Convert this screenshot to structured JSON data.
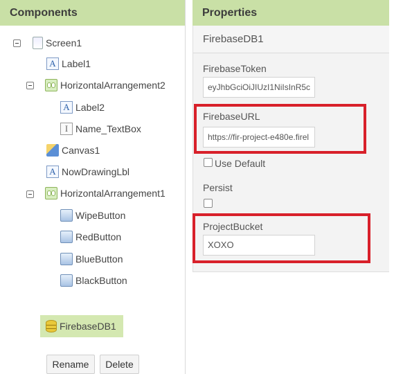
{
  "components": {
    "header": "Components",
    "tree": [
      {
        "name": "Screen1",
        "icon": "screen-icon"
      },
      {
        "name": "Label1",
        "icon": "label-icon"
      },
      {
        "name": "HorizontalArrangement2",
        "icon": "horizontal-arrangement-icon"
      },
      {
        "name": "Label2",
        "icon": "label-icon"
      },
      {
        "name": "Name_TextBox",
        "icon": "textbox-icon"
      },
      {
        "name": "Canvas1",
        "icon": "canvas-icon"
      },
      {
        "name": "NowDrawingLbl",
        "icon": "label-icon"
      },
      {
        "name": "HorizontalArrangement1",
        "icon": "horizontal-arrangement-icon"
      },
      {
        "name": "WipeButton",
        "icon": "button-icon"
      },
      {
        "name": "RedButton",
        "icon": "button-icon"
      },
      {
        "name": "BlueButton",
        "icon": "button-icon"
      },
      {
        "name": "BlackButton",
        "icon": "button-icon"
      },
      {
        "name": "FirebaseDB1",
        "icon": "firebase-db-icon",
        "selected": true
      }
    ],
    "rename_label": "Rename",
    "delete_label": "Delete"
  },
  "properties": {
    "header": "Properties",
    "component_name": "FirebaseDB1",
    "firebase_token": {
      "label": "FirebaseToken",
      "value": "eyJhbGciOiJIUzI1NiIsInR5c"
    },
    "firebase_url": {
      "label": "FirebaseURL",
      "value": "https://fir-project-e480e.firel"
    },
    "use_default": {
      "label": "Use Default",
      "checked": false
    },
    "persist": {
      "label": "Persist",
      "checked": false
    },
    "project_bucket": {
      "label": "ProjectBucket",
      "value": "XOXO"
    }
  },
  "colors": {
    "header_bg": "#c9e0a6",
    "selected_bg": "#d4e8b1",
    "highlight_red": "#d8202a"
  }
}
